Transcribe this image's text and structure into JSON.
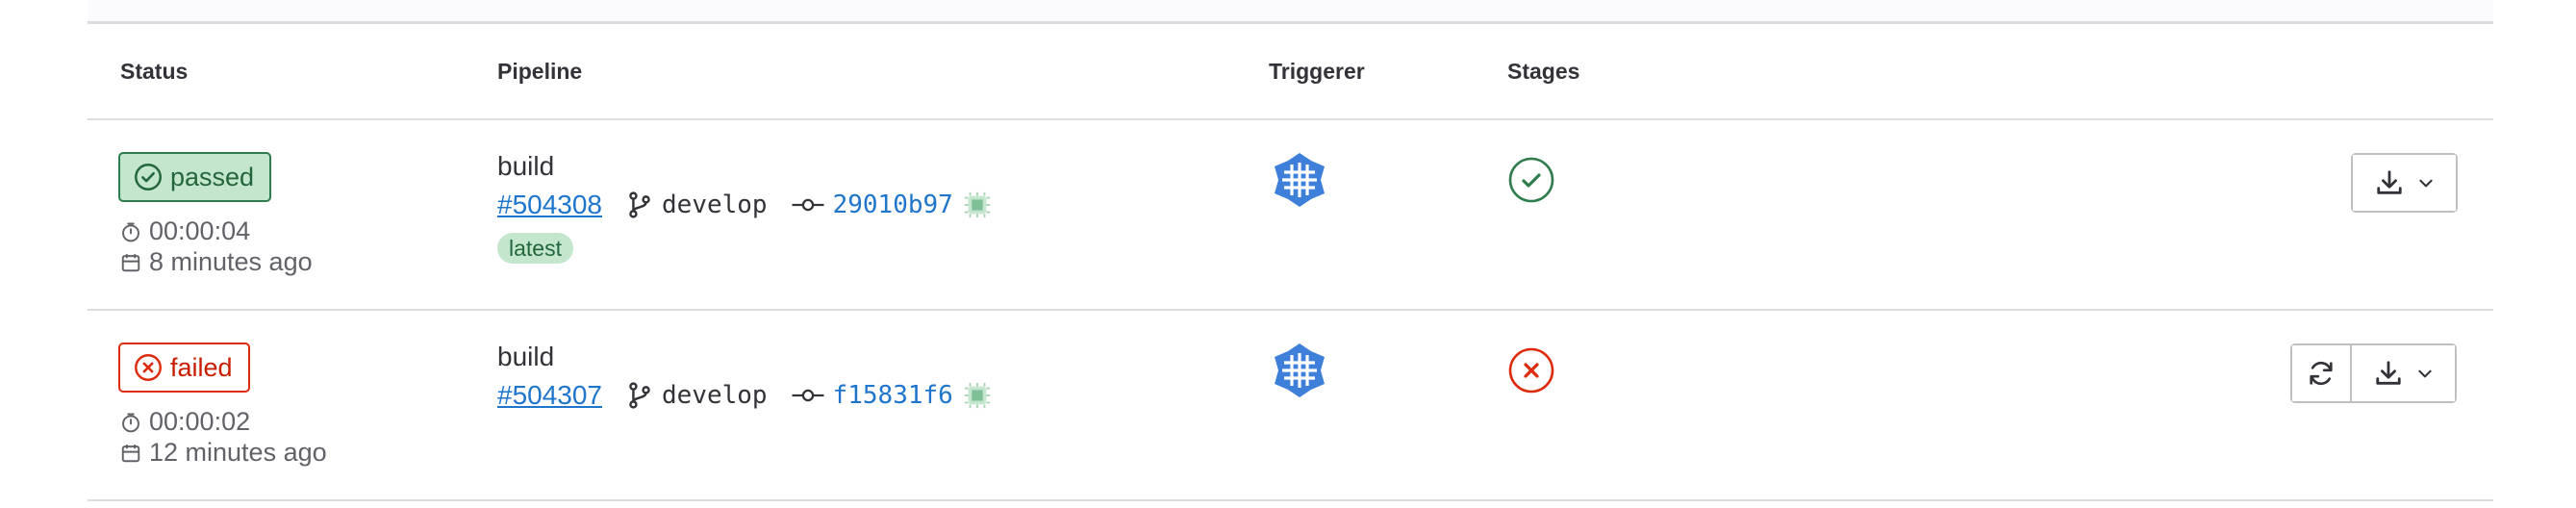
{
  "table": {
    "headers": {
      "status": "Status",
      "pipeline": "Pipeline",
      "triggerer": "Triggerer",
      "stages": "Stages"
    }
  },
  "rows": [
    {
      "status": {
        "label": "passed",
        "state": "success",
        "duration": "00:00:04",
        "finished": "8 minutes ago"
      },
      "pipeline": {
        "name": "build",
        "id": "#504308",
        "ref": "develop",
        "sha": "29010b97",
        "badge": "latest"
      },
      "triggerer": {
        "avatar": "identicon-avatar"
      },
      "stage": {
        "state": "success",
        "icon": "check-circle-icon"
      },
      "actions": {
        "retry": false,
        "download": true
      }
    },
    {
      "status": {
        "label": "failed",
        "state": "failed",
        "duration": "00:00:02",
        "finished": "12 minutes ago"
      },
      "pipeline": {
        "name": "build",
        "id": "#504307",
        "ref": "develop",
        "sha": "f15831f6",
        "badge": ""
      },
      "triggerer": {
        "avatar": "identicon-avatar"
      },
      "stage": {
        "state": "failed",
        "icon": "close-circle-icon"
      },
      "actions": {
        "retry": true,
        "download": true
      }
    }
  ],
  "colors": {
    "success": "#24663b",
    "success_bg": "#c3e6cd",
    "failed": "#dd2b0e",
    "link": "#1f75cb",
    "avatar": "#3d7fd9"
  }
}
